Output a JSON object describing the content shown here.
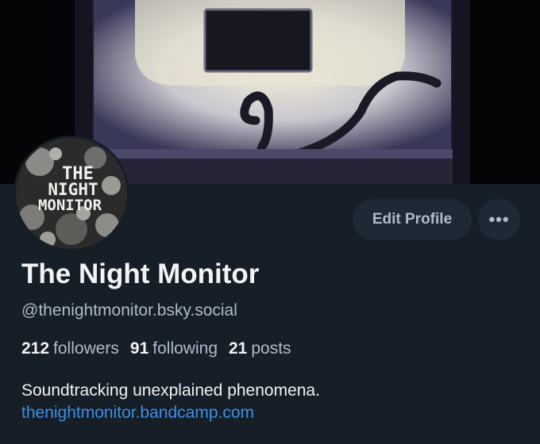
{
  "banner": {
    "description_icon": "phone-booth-banner"
  },
  "avatar": {
    "lines": [
      "THE",
      "NIGHT",
      "MONITOR"
    ]
  },
  "actions": {
    "edit_label": "Edit Profile",
    "more_label": "•••"
  },
  "profile": {
    "display_name": "The Night Monitor",
    "handle": "@thenightmonitor.bsky.social",
    "followers_count": "212",
    "followers_label": "followers",
    "following_count": "91",
    "following_label": "following",
    "posts_count": "21",
    "posts_label": "posts",
    "bio": "Soundtracking unexplained phenomena.",
    "link": "thenightmonitor.bandcamp.com"
  },
  "colors": {
    "background": "#161e27",
    "muted": "#aebbc9",
    "link": "#3d8fe8",
    "button": "#1e2936"
  }
}
